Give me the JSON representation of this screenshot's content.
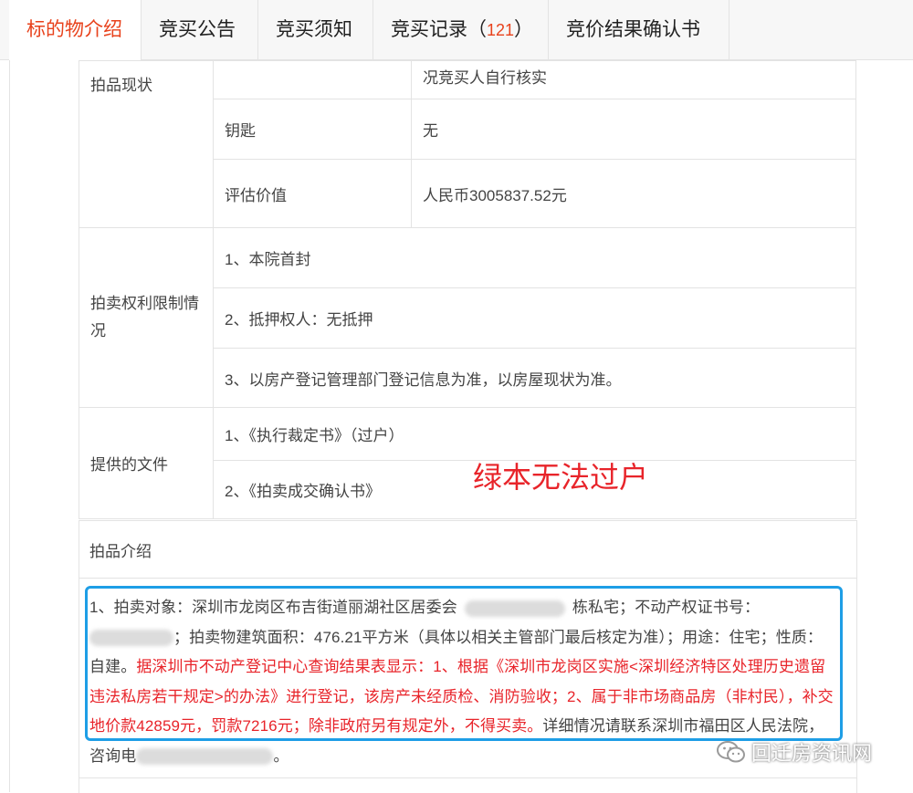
{
  "tabs": [
    {
      "label": "标的物介绍"
    },
    {
      "label": "竞买公告"
    },
    {
      "label": "竞买须知"
    },
    {
      "label": "竞买记录",
      "count": "121",
      "open": "（",
      "close": "）"
    },
    {
      "label": "竞价结果确认书"
    }
  ],
  "table": {
    "status_head": "拍品现状",
    "status_rows": [
      {
        "label": "",
        "value": "况竞买人自行核实"
      },
      {
        "label": "钥匙",
        "value": "无"
      },
      {
        "label": "评估价值",
        "value": "人民币3005837.52元"
      }
    ],
    "rights_head": "拍卖权利限制情况",
    "rights_rows": [
      "1、本院首封",
      "2、抵押权人：无抵押",
      "3、以房产登记管理部门登记信息为准，以房屋现状为准。"
    ],
    "docs_head": "提供的文件",
    "docs_rows": [
      "1、《执行裁定书》（过户）",
      "2、《拍卖成交确认书》"
    ]
  },
  "annotation": "绿本无法过户",
  "intro": {
    "title": "拍品介绍",
    "p1": "1、拍卖对象：深圳市龙岗区布吉街道丽湖社区居委会",
    "p2": "栋私宅；不动产权证书号：",
    "p3": "；拍卖物建筑面积：476.21平方米（具体以相关主管部门最后核定为准）；用途：住宅；性质：自建。",
    "p4_red": "据深圳市不动产登记中心查询结果表显示：1、根据《深圳市龙岗区实施<深圳经济特区处理历史遗留违法私房若干规定>的办法》进行登记，该房产未经质检、消防验收；2、属于非市场商品房（非村民），补交地价款42859元，罚款7216元；除非政府另有规定外，不得买卖。",
    "p5": "详细情况请联系深圳市福田区人民法院，咨询电",
    "p6": "。"
  },
  "watermark": {
    "text": "回迁房资讯网",
    "icon": "wechat-icon"
  }
}
